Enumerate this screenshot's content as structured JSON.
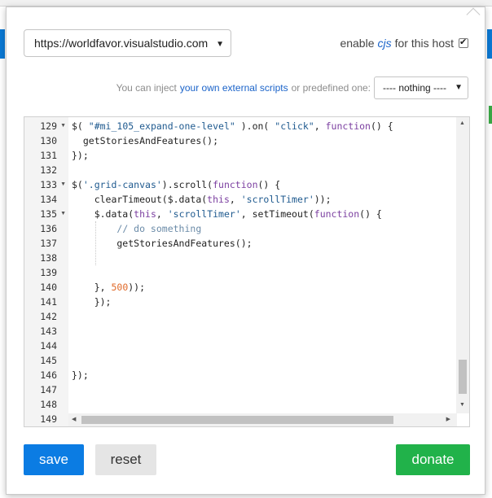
{
  "host_select": {
    "value": "https://worldfavor.visualstudio.com"
  },
  "enable": {
    "prefix": "enable",
    "cjs": "cjs",
    "suffix": "for this host",
    "checked": true
  },
  "inject": {
    "prefix": "You can inject",
    "link": "your own external scripts",
    "suffix": "or predefined one:",
    "selected": "---- nothing ----"
  },
  "editor": {
    "line_numbers": [
      "129",
      "130",
      "131",
      "132",
      "133",
      "134",
      "135",
      "136",
      "137",
      "138",
      "139",
      "140",
      "141",
      "142",
      "143",
      "144",
      "145",
      "146",
      "147",
      "148",
      "149"
    ],
    "folds": [
      "129",
      "133",
      "135"
    ]
  },
  "buttons": {
    "save": "save",
    "reset": "reset",
    "donate": "donate"
  },
  "colors": {
    "save": "#0b7ce3",
    "donate": "#21b24a",
    "reset": "#e5e5e5",
    "link": "#1a63c9"
  }
}
